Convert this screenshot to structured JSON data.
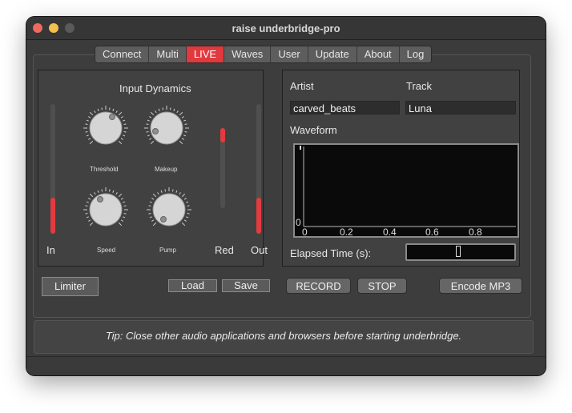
{
  "window": {
    "title": "raise underbridge-pro"
  },
  "tabs": [
    {
      "label": "Connect"
    },
    {
      "label": "Multi"
    },
    {
      "label": "LIVE",
      "active": true
    },
    {
      "label": "Waves"
    },
    {
      "label": "User"
    },
    {
      "label": "Update"
    },
    {
      "label": "About"
    },
    {
      "label": "Log"
    }
  ],
  "dynamics": {
    "title": "Input Dynamics",
    "meters": {
      "in_label": "In",
      "red_label": "Red",
      "out_label": "Out",
      "in_level": 0.28,
      "red_level": 0.18,
      "out_level": 0.28
    },
    "knobs": {
      "threshold": "Threshold",
      "makeup": "Makeup",
      "speed": "Speed",
      "pump": "Pump"
    }
  },
  "track_info": {
    "artist_label": "Artist",
    "artist_value": "carved_beats",
    "track_label": "Track",
    "track_value": "Luna",
    "waveform_label": "Waveform",
    "elapsed_label": "Elapsed Time (s):",
    "waveform_axis": {
      "x_ticks": [
        "0",
        "0.2",
        "0.4",
        "0.6",
        "0.8"
      ],
      "y_tick": "0"
    }
  },
  "buttons": {
    "limiter": "Limiter",
    "load": "Load",
    "save": "Save",
    "record": "RECORD",
    "stop": "STOP",
    "encode": "Encode MP3"
  },
  "tip": "Tip: Close other audio applications and browsers before starting underbridge.",
  "colors": {
    "accent": "#e0393e",
    "background": "#3b3b3b"
  }
}
